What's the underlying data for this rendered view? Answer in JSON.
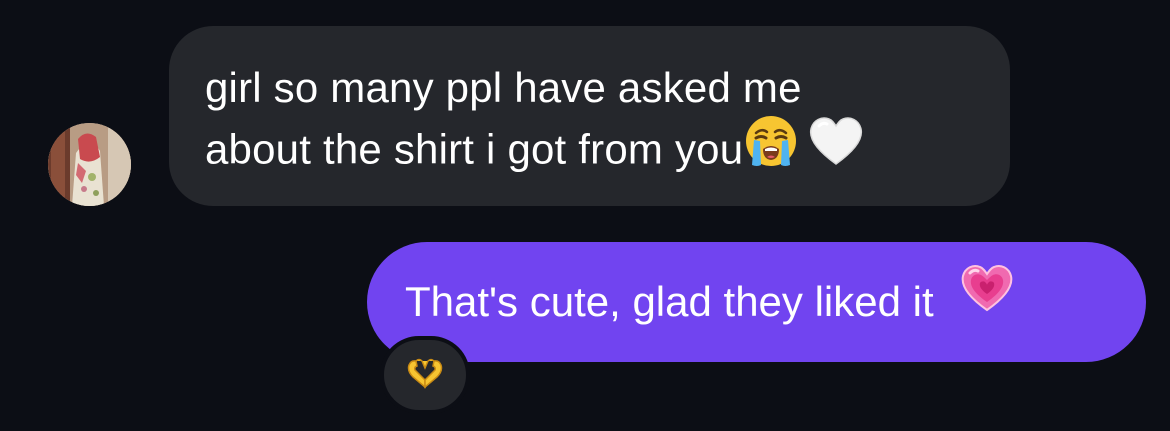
{
  "conversation": {
    "incoming_message": {
      "lines": [
        "girl so many ppl have asked me",
        "about the shirt i got from you"
      ],
      "emojis": [
        "loudly-crying-face",
        "white-heart"
      ]
    },
    "outgoing_message": {
      "text": "That's cute, glad they liked it",
      "emoji": "growing-heart"
    },
    "reaction": {
      "emoji": "heart-hands"
    }
  },
  "colors": {
    "background": "#0c0e15",
    "incoming_bubble": "#25272c",
    "outgoing_bubble": "#7144f0",
    "text": "#ffffff"
  }
}
